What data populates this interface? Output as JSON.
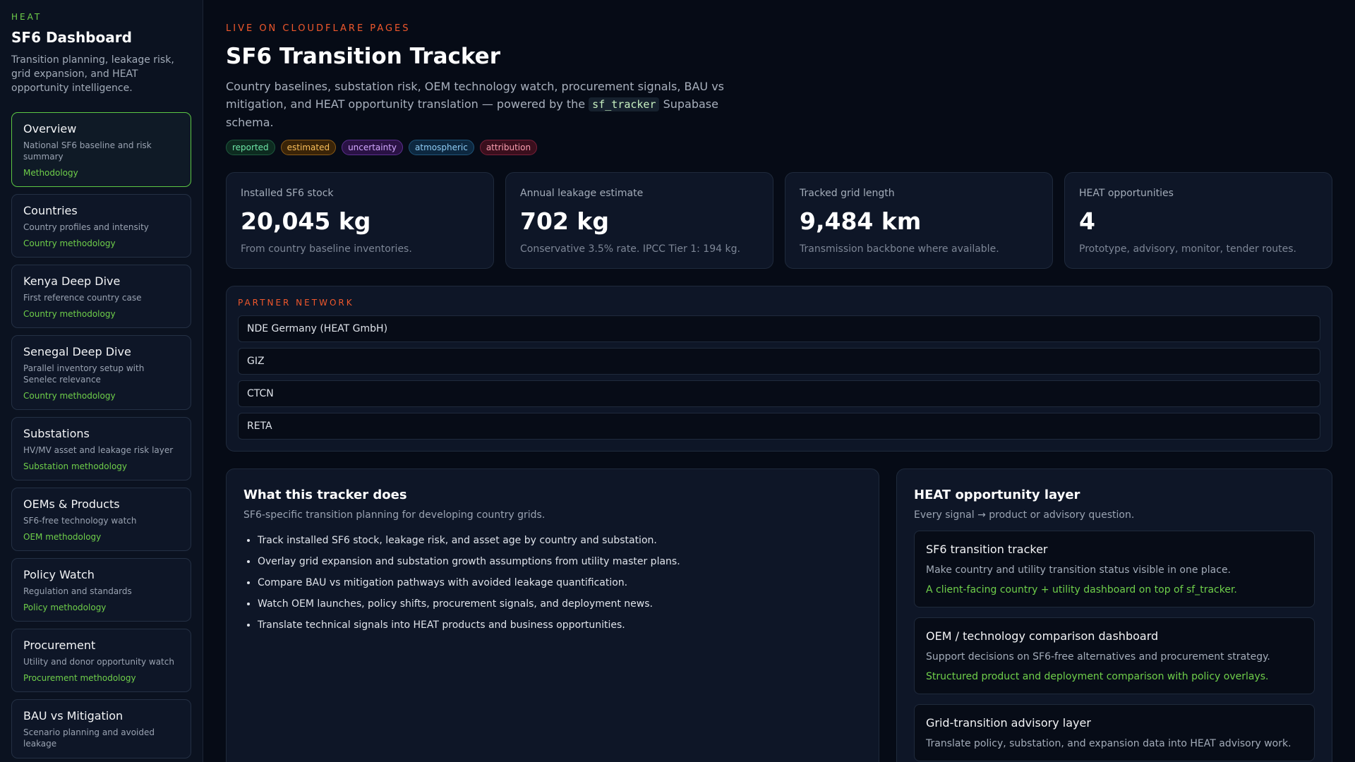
{
  "sidebar": {
    "kicker": "HEAT",
    "title": "SF6 Dashboard",
    "description": "Transition planning, leakage risk, grid expansion, and HEAT opportunity intelligence.",
    "items": [
      {
        "title": "Overview",
        "subtitle": "National SF6 baseline and risk summary",
        "link": "Methodology"
      },
      {
        "title": "Countries",
        "subtitle": "Country profiles and intensity",
        "link": "Country methodology"
      },
      {
        "title": "Kenya Deep Dive",
        "subtitle": "First reference country case",
        "link": "Country methodology"
      },
      {
        "title": "Senegal Deep Dive",
        "subtitle": "Parallel inventory setup with Senelec relevance",
        "link": "Country methodology"
      },
      {
        "title": "Substations",
        "subtitle": "HV/MV asset and leakage risk layer",
        "link": "Substation methodology"
      },
      {
        "title": "OEMs & Products",
        "subtitle": "SF6-free technology watch",
        "link": "OEM methodology"
      },
      {
        "title": "Policy Watch",
        "subtitle": "Regulation and standards",
        "link": "Policy methodology"
      },
      {
        "title": "Procurement",
        "subtitle": "Utility and donor opportunity watch",
        "link": "Procurement methodology"
      },
      {
        "title": "BAU vs Mitigation",
        "subtitle": "Scenario planning and avoided leakage",
        "link": ""
      }
    ]
  },
  "header": {
    "kicker": "LIVE ON CLOUDFLARE PAGES",
    "title": "SF6 Transition Tracker",
    "desc_before": "Country baselines, substation risk, OEM technology watch, procurement signals, BAU vs mitigation, and HEAT opportunity translation — powered by the",
    "desc_code": "sf_tracker",
    "desc_after": "Supabase schema.",
    "tags": [
      "reported",
      "estimated",
      "uncertainty",
      "atmospheric",
      "attribution"
    ]
  },
  "stats": [
    {
      "label": "Installed SF6 stock",
      "value": "20,045 kg",
      "note": "From country baseline inventories."
    },
    {
      "label": "Annual leakage estimate",
      "value": "702 kg",
      "note": "Conservative 3.5% rate. IPCC Tier 1: 194 kg."
    },
    {
      "label": "Tracked grid length",
      "value": "9,484 km",
      "note": "Transmission backbone where available."
    },
    {
      "label": "HEAT opportunities",
      "value": "4",
      "note": "Prototype, advisory, monitor, tender routes."
    }
  ],
  "partners": {
    "kicker": "PARTNER NETWORK",
    "items": [
      "NDE Germany (HEAT GmbH)",
      "GIZ",
      "CTCN",
      "RETA"
    ]
  },
  "tracker": {
    "title": "What this tracker does",
    "subtitle": "SF6-specific transition planning for developing country grids.",
    "bullets": [
      "Track installed SF6 stock, leakage risk, and asset age by country and substation.",
      "Overlay grid expansion and substation growth assumptions from utility master plans.",
      "Compare BAU vs mitigation pathways with avoided leakage quantification.",
      "Watch OEM launches, policy shifts, procurement signals, and deployment news.",
      "Translate technical signals into HEAT products and business opportunities."
    ]
  },
  "opportunity": {
    "title": "HEAT opportunity layer",
    "subtitle": "Every signal → product or advisory question.",
    "cards": [
      {
        "title": "SF6 transition tracker",
        "desc": "Make country and utility transition status visible in one place.",
        "note": "A client-facing country + utility dashboard on top of sf_tracker."
      },
      {
        "title": "OEM / technology comparison dashboard",
        "desc": "Support decisions on SF6-free alternatives and procurement strategy.",
        "note": "Structured product and deployment comparison with policy overlays."
      },
      {
        "title": "Grid-transition advisory layer",
        "desc": "Translate policy, substation, and expansion data into HEAT advisory work.",
        "note": ""
      }
    ]
  }
}
